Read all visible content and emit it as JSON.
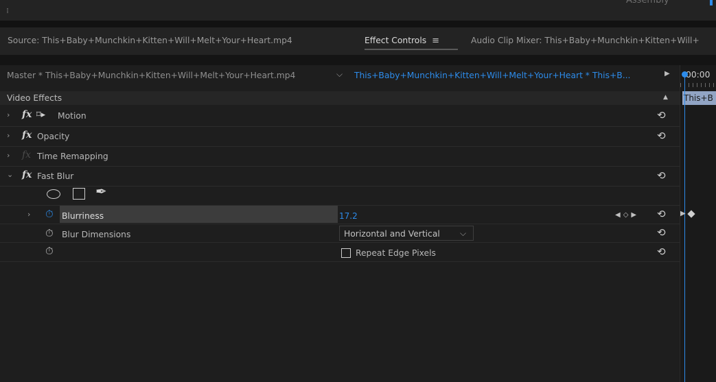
{
  "workspace": {
    "name": "Assembly"
  },
  "tabs": {
    "source": "Source: This+Baby+Munchkin+Kitten+Will+Melt+Your+Heart.mp4",
    "effect_controls": "Effect Controls",
    "effect_controls_menu": "≡",
    "audio_clip_mixer": "Audio Clip Mixer: This+Baby+Munchkin+Kitten+Will+"
  },
  "header": {
    "master": "Master * This+Baby+Munchkin+Kitten+Will+Melt+Your+Heart.mp4",
    "clip": "This+Baby+Munchkin+Kitten+Will+Melt+Your+Heart * This+B..."
  },
  "section": {
    "label": "Video Effects"
  },
  "effects": [
    {
      "name": "Motion"
    },
    {
      "name": "Opacity"
    },
    {
      "name": "Time Remapping"
    },
    {
      "name": "Fast Blur"
    }
  ],
  "fast_blur": {
    "blurriness_label": "Blurriness",
    "blurriness_value": "17.2",
    "blur_dimensions_label": "Blur Dimensions",
    "blur_dimensions_value": "Horizontal and Vertical",
    "repeat_edge_label": "Repeat Edge Pixels",
    "repeat_edge_checked": false
  },
  "timeline": {
    "timecode": "00:00",
    "clip_label": "This+B"
  },
  "colors": {
    "accent": "#2d8ceb",
    "clip": "#91a4c4"
  }
}
